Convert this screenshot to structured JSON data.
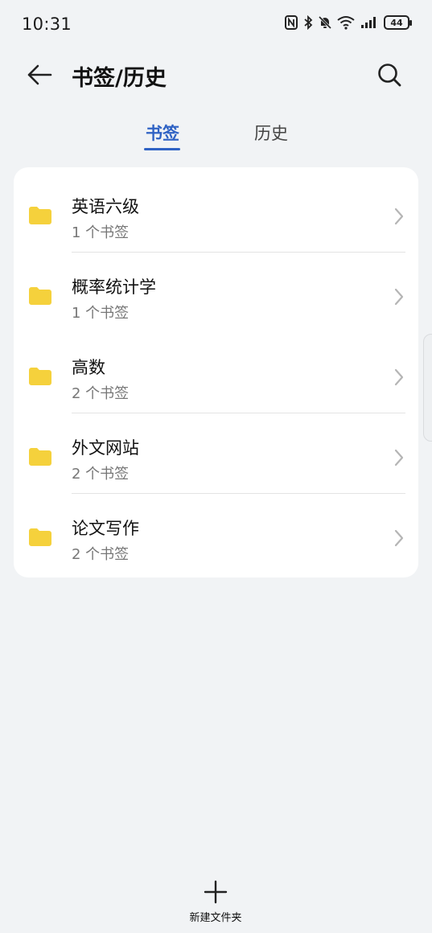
{
  "status_bar": {
    "time": "10:31",
    "battery": "44",
    "icons": [
      "nfc-icon",
      "bluetooth-icon",
      "bell-off-icon",
      "wifi-icon",
      "signal-icon",
      "battery-icon"
    ]
  },
  "header": {
    "title": "书签/历史",
    "back_icon": "arrow-left-icon",
    "search_icon": "search-icon"
  },
  "tabs": [
    {
      "label": "书签",
      "active": true
    },
    {
      "label": "历史",
      "active": false
    }
  ],
  "folders": [
    {
      "name": "英语六级",
      "count": "1 个书签"
    },
    {
      "name": "概率统计学",
      "count": "1 个书签"
    },
    {
      "name": "高数",
      "count": "2 个书签"
    },
    {
      "name": "外文网站",
      "count": "2 个书签"
    },
    {
      "name": "论文写作",
      "count": "2 个书签"
    }
  ],
  "bottom_action": {
    "label": "新建文件夹",
    "icon": "plus-icon"
  },
  "colors": {
    "accent": "#2f62c4",
    "folder": "#f5d13c",
    "background": "#f1f3f5",
    "card": "#ffffff"
  }
}
